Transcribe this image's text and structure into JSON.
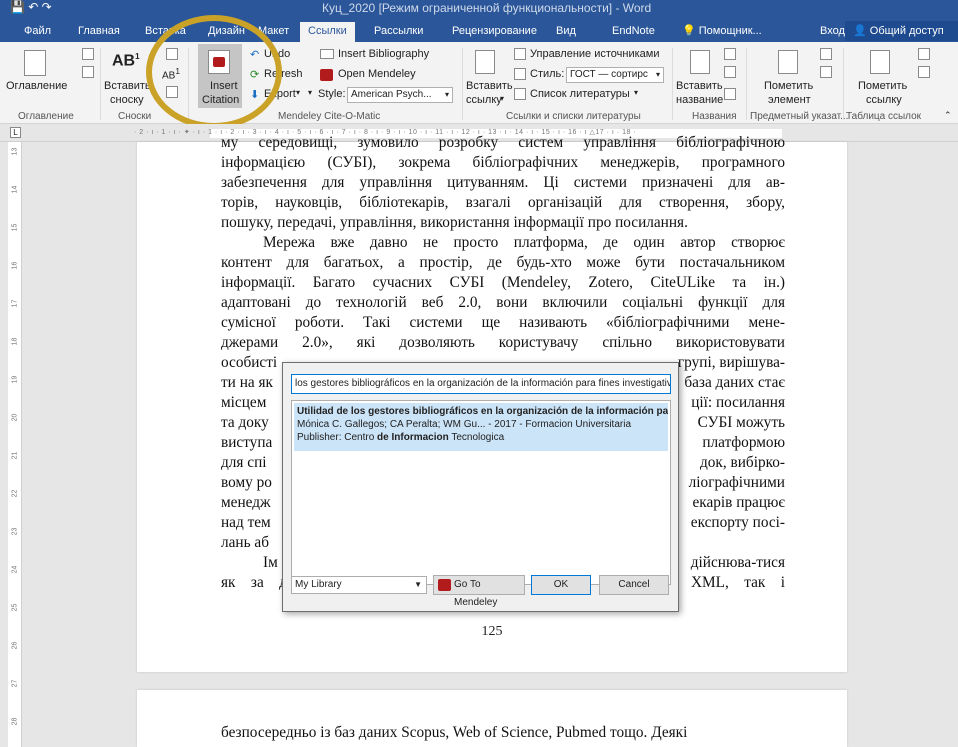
{
  "window": {
    "title": "Куц_2020 [Режим ограниченной функциональности] - Word"
  },
  "tabs": [
    "Файл",
    "Главная",
    "Вставка",
    "Дизайн",
    "Макет",
    "Ссылки",
    "Рассылки",
    "Рецензирование",
    "Вид",
    "EndNote",
    "Помощник..."
  ],
  "account": {
    "signin": "Вход",
    "share": "Общий доступ"
  },
  "ribbon": {
    "toc": {
      "label": "Оглавление",
      "group": "Оглавление"
    },
    "footnotes": {
      "insert_line1": "Вставить",
      "insert_line2": "сноску",
      "group": "Сноски"
    },
    "mendeley": {
      "insert_citation_line1": "Insert",
      "insert_citation_line2": "Citation",
      "undo": "Undo",
      "refresh": "Refresh",
      "export": "Export",
      "insert_bibliography": "Insert Bibliography",
      "open_mendeley": "Open Mendeley",
      "style_label": "Style:",
      "style_value": "American Psych...",
      "group": "Mendeley Cite-O-Matic"
    },
    "citations": {
      "manage_sources": "Управление источниками",
      "style_label": "Стиль:",
      "style_value": "ГОСТ — сортирс",
      "bibliography": "Список литературы",
      "insert_line1": "Вставить",
      "insert_line2": "ссылку",
      "group": "Ссылки и списки литературы"
    },
    "captions": {
      "insert_line1": "Вставить",
      "insert_line2": "название",
      "group": "Названия"
    },
    "index": {
      "mark_line1": "Пометить",
      "mark_line2": "элемент",
      "group": "Предметный указат..."
    },
    "toa": {
      "mark_line1": "Пометить",
      "mark_line2": "ссылку",
      "group": "Таблица ссылок"
    }
  },
  "ruler": {
    "ticks": "· 2 · ı · 1 · ı · ✦ · ı · 1 · ı · 2 · ı · 3 · ı · 4 · ı · 5 · ı · 6 · ı · 7 · ı · 8 · ı · 9 · ı · 10 · ı · 11 · ı · 12 · ı · 13 · ı · 14 · ı · 15 · ı · 16 · ı △17 · ı · 18 ·",
    "left": [
      "13",
      "14",
      "15",
      "16",
      "17",
      "18",
      "19",
      "20",
      "21",
      "22",
      "23",
      "24",
      "25",
      "26",
      "27",
      "28"
    ]
  },
  "page1": {
    "lines": [
      "му середовищі, зумовило розробку систем управління бібліографічною",
      "інформацією (СУБІ), зокрема бібліографічних менеджерів, програмного",
      "забезпечення для управління цитуванням. Ці системи призначені для ав-",
      "торів, науковців, бібліотекарів, взагалі організацій для створення, збору,",
      "пошуку, передачі, управління, використання інформації про посилання.",
      "Мережа вже давно не просто платформа, де один автор створює",
      "контент для багатьох, а простір, де будь-хто може бути постачальником",
      "інформації. Багато сучасних СУБІ (Mendeley, Zotero, CiteULike та ін.)",
      "адаптовані до технологій веб 2.0, вони включили соціальні функції для",
      "сумісної роботи. Такі системи ще називають «бібліографічними мене-",
      "джерами 2.0», які дозволяють користувачу спільно використовувати",
      "особисті",
      "ти на як",
      "місцем",
      "та доку",
      "виступа",
      "для спі",
      "вому ро",
      "менедж",
      "над тем",
      "лань аб",
      "Ім",
      "як за допомогою спеціальних форматів типу BibTex, RIS, XML, так і"
    ],
    "right_fragments": [
      "групі, вирішува-",
      "база даних стає",
      "ції: посилання",
      "СУБІ можуть",
      "платформою",
      "док, вибірко-",
      "ліографічними",
      "екарів працює",
      "експорту посі-",
      "",
      "дійснюва-тися"
    ],
    "page_number": "125"
  },
  "page2": {
    "first_line": "безпосередньо із баз даних Scopus, Web of Science, Pubmed тощо. Деякі"
  },
  "dialog": {
    "search_value": "los gestores bibliográficos en la organización de la información para fines investigativos",
    "result": {
      "title": "Utilidad de los gestores bibliográficos en la organización de la información para fines investigativos",
      "authors": "Mónica C. Gallegos; CA Peralta; WM Gu... - 2017 - Formacion Universitaria",
      "publisher_prefix": "Publisher: Centro",
      "publisher_bold": "de Informacion",
      "publisher_suffix": "Tecnologica"
    },
    "library": "My Library",
    "go_to_mendeley": "Go To Mendeley",
    "ok": "OK",
    "cancel": "Cancel"
  },
  "colors": {
    "word_blue": "#2b579a",
    "highlight_ring": "#c9a227",
    "mendeley_red": "#b11b1b",
    "selection": "#cce4f7"
  }
}
